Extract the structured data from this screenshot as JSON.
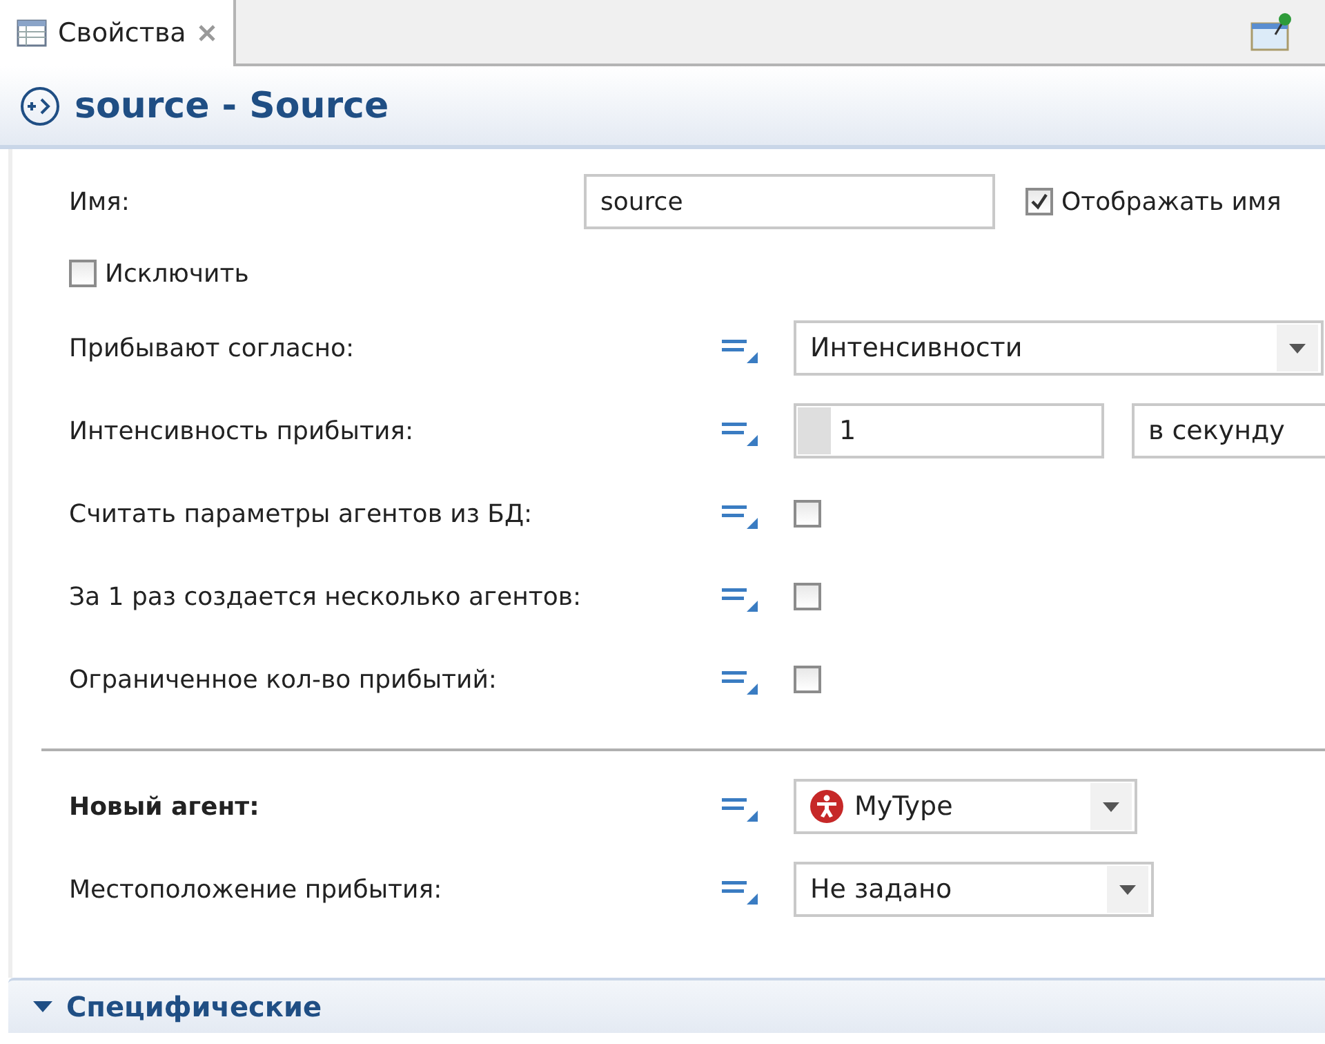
{
  "tab": {
    "label": "Свойства",
    "selected": true
  },
  "header": {
    "title": "source - Source"
  },
  "name_row": {
    "label": "Имя:",
    "value": "source",
    "show_name": {
      "label": "Отображать имя",
      "checked": true
    }
  },
  "exclude": {
    "label": "Исключить",
    "checked": false
  },
  "properties": [
    {
      "kind": "combo",
      "label": "Прибывают согласно:",
      "value": "Интенсивности"
    },
    {
      "kind": "number",
      "label": "Интенсивность прибытия:",
      "value": "1",
      "unit": "в секунду"
    },
    {
      "kind": "checkbox",
      "label": "Считать параметры агентов из БД:",
      "checked": false
    },
    {
      "kind": "checkbox",
      "label": "За 1 раз создается несколько агентов:",
      "checked": false
    },
    {
      "kind": "checkbox",
      "label": "Ограниченное кол-во прибытий:",
      "checked": false
    }
  ],
  "agent_properties": [
    {
      "kind": "agent-combo",
      "label": "Новый агент:",
      "bold": true,
      "value": "MyType"
    },
    {
      "kind": "combo",
      "label": "Местоположение прибытия:",
      "bold": false,
      "value": "Не задано"
    }
  ],
  "section": {
    "label": "Специфические",
    "expanded": true
  }
}
